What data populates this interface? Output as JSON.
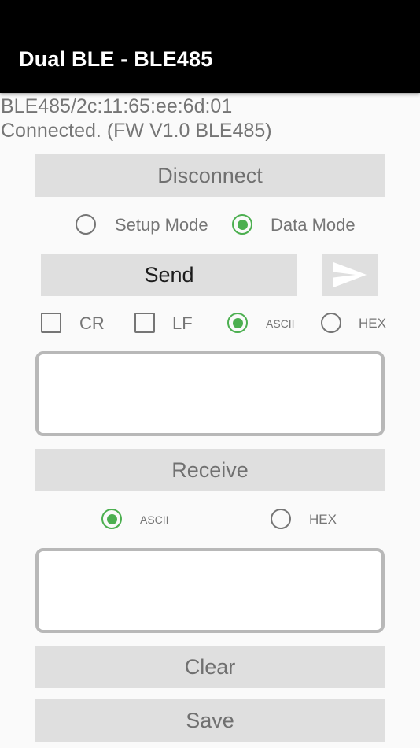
{
  "appbar": {
    "title": "Dual BLE - BLE485"
  },
  "device": {
    "address": "BLE485/2c:11:65:ee:6d:01",
    "status": "Connected. (FW V1.0 BLE485)"
  },
  "buttons": {
    "disconnect": "Disconnect",
    "send": "Send",
    "receive": "Receive",
    "clear": "Clear",
    "save": "Save"
  },
  "mode": {
    "options": [
      "Setup Mode",
      "Data Mode"
    ],
    "selected": "Data Mode"
  },
  "send_options": {
    "cr": "CR",
    "lf": "LF",
    "cr_checked": false,
    "lf_checked": false,
    "format_options": [
      "ASCII",
      "HEX"
    ],
    "format_selected": "ASCII"
  },
  "receive_options": {
    "format_options": [
      "ASCII",
      "HEX"
    ],
    "format_selected": "ASCII"
  },
  "send_input": {
    "value": ""
  },
  "receive_output": {
    "value": ""
  },
  "icons": {
    "send_arrow": "send-arrow-icon"
  },
  "colors": {
    "appbar": "#000000",
    "accent": "#4caf50",
    "button_bg": "#dfdfdf",
    "background": "#fafafa"
  }
}
